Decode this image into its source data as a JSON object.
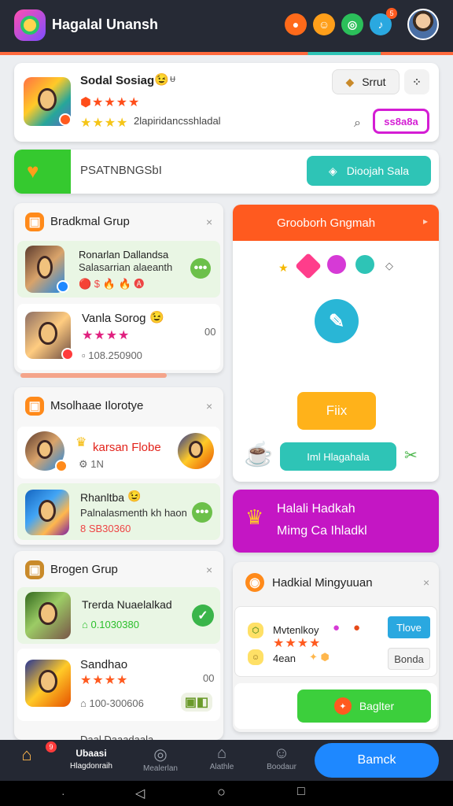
{
  "header": {
    "title": "Hagalal Unansh",
    "notification_count": "5",
    "icons": [
      "fire-icon",
      "smile-icon",
      "chat-icon",
      "bell-icon"
    ],
    "icon_colors": [
      "#ff6a1a",
      "#ff9f1a",
      "#2bbf5a",
      "#2aa8e0"
    ]
  },
  "featured": {
    "title": "Sodal Sosiag",
    "emoji": "😉",
    "title_extra": "ᵾ",
    "subtitle": "2lapiridancsshladal",
    "sort_button": "Srrut",
    "code_button": "ss8a8a"
  },
  "banner": {
    "label": "PSATNBNGSbI",
    "action": "Dioojah Sala"
  },
  "group1": {
    "title": "Bradkmal Grup",
    "items": [
      {
        "title": "Ronarlan Dallandsa",
        "subtitle": "Salasarrian alaeanth",
        "meta": "🔴 $ 🔥 🔥 🅐"
      },
      {
        "title": "Vanla Sorog",
        "emoji": "😉",
        "meta": "108.250900",
        "count": "00"
      }
    ]
  },
  "group2": {
    "title": "Msolhaae Ilorotye",
    "items": [
      {
        "title": "karsan Flobe",
        "meta": "1N"
      },
      {
        "title": "Rhanltba",
        "emoji": "😉",
        "subtitle": "Palnalasmenth kh haon",
        "meta": "8 SB30360"
      }
    ]
  },
  "group3": {
    "title": "Brogen Grup",
    "items": [
      {
        "title": "Trerda Nuaelalkad",
        "meta": "0.1030380"
      },
      {
        "title": "Sandhao",
        "meta": "100-300606",
        "count": "00"
      },
      {
        "title": "Daal Daaadaala"
      }
    ]
  },
  "panel": {
    "title": "Grooborh Gngmah",
    "fix_button": "Fiix",
    "action_button": "Iml Hlagahala"
  },
  "promo": {
    "line1": "Halali Hadkah",
    "line2": "Mimg Ca Ihladkl"
  },
  "panel2": {
    "title": "Hadkial Mingyuuan",
    "row_title": "Mvtenlkoy",
    "row_subtitle": "4ean",
    "tag1": "Tlove",
    "tag2": "Bonda",
    "action": "Baglter"
  },
  "bottom_nav": {
    "items": [
      {
        "label": "Hlagdonraih",
        "title": "Ubaasi",
        "icon": "home-icon"
      },
      {
        "label": "Mealerlan",
        "icon": "compass-icon"
      },
      {
        "label": "Alathle",
        "icon": "bag-icon"
      },
      {
        "label": "Boodaur",
        "icon": "profile-icon"
      }
    ],
    "badge": "9",
    "cta": "Bamck"
  },
  "colors": {
    "accent": "#ff5a1f",
    "teal": "#2ec4b6",
    "green": "#3ccf3c",
    "magenta": "#c416c4",
    "blue": "#1e88ff"
  }
}
